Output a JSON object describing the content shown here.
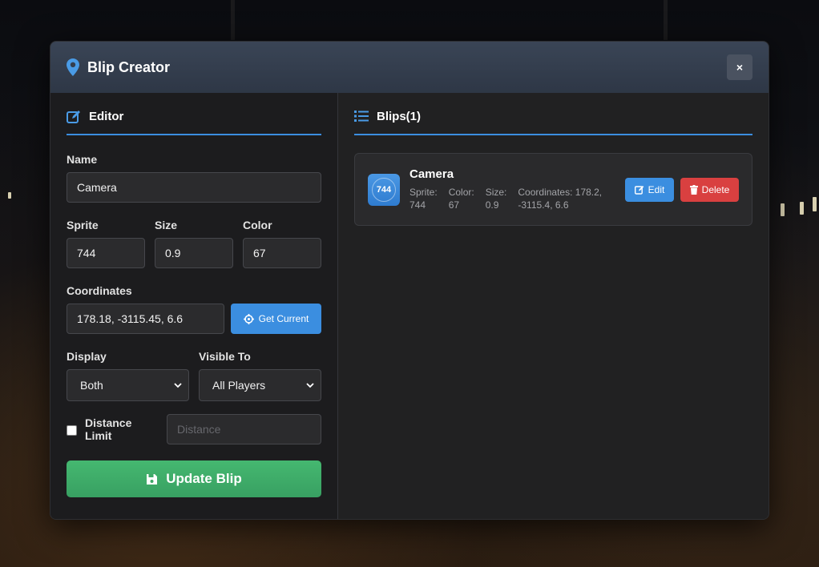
{
  "modal": {
    "title": "Blip Creator",
    "close_label": "×"
  },
  "editor": {
    "section_title": "Editor",
    "name_label": "Name",
    "name_value": "Camera",
    "sprite_label": "Sprite",
    "sprite_value": "744",
    "size_label": "Size",
    "size_value": "0.9",
    "color_label": "Color",
    "color_value": "67",
    "coords_label": "Coordinates",
    "coords_value": "178.18, -3115.45, 6.6",
    "get_current_label": "Get Current",
    "display_label": "Display",
    "display_value": "Both",
    "visible_label": "Visible To",
    "visible_value": "All Players",
    "distance_label": "Distance Limit",
    "distance_placeholder": "Distance",
    "distance_checked": false,
    "update_label": "Update Blip"
  },
  "blips": {
    "section_title": "Blips(1)",
    "items": [
      {
        "badge": "744",
        "name": "Camera",
        "sprite_label": "Sprite:",
        "sprite_value": "744",
        "color_label": "Color:",
        "color_value": "67",
        "size_label": "Size:",
        "size_value": "0.9",
        "coords_label": "Coordinates: 178.2,",
        "coords_value": "-3115.4, 6.6",
        "edit_label": "Edit",
        "delete_label": "Delete"
      }
    ]
  },
  "icons": {
    "title": "map-marker-icon",
    "editor": "edit-icon",
    "blips": "list-icon",
    "get_current": "crosshair-icon",
    "update": "save-icon",
    "edit": "edit-icon",
    "delete": "trash-icon"
  },
  "colors": {
    "accent": "#3b8ee0",
    "success": "#42b06a",
    "danger": "#d94040",
    "header": "#343f50"
  }
}
